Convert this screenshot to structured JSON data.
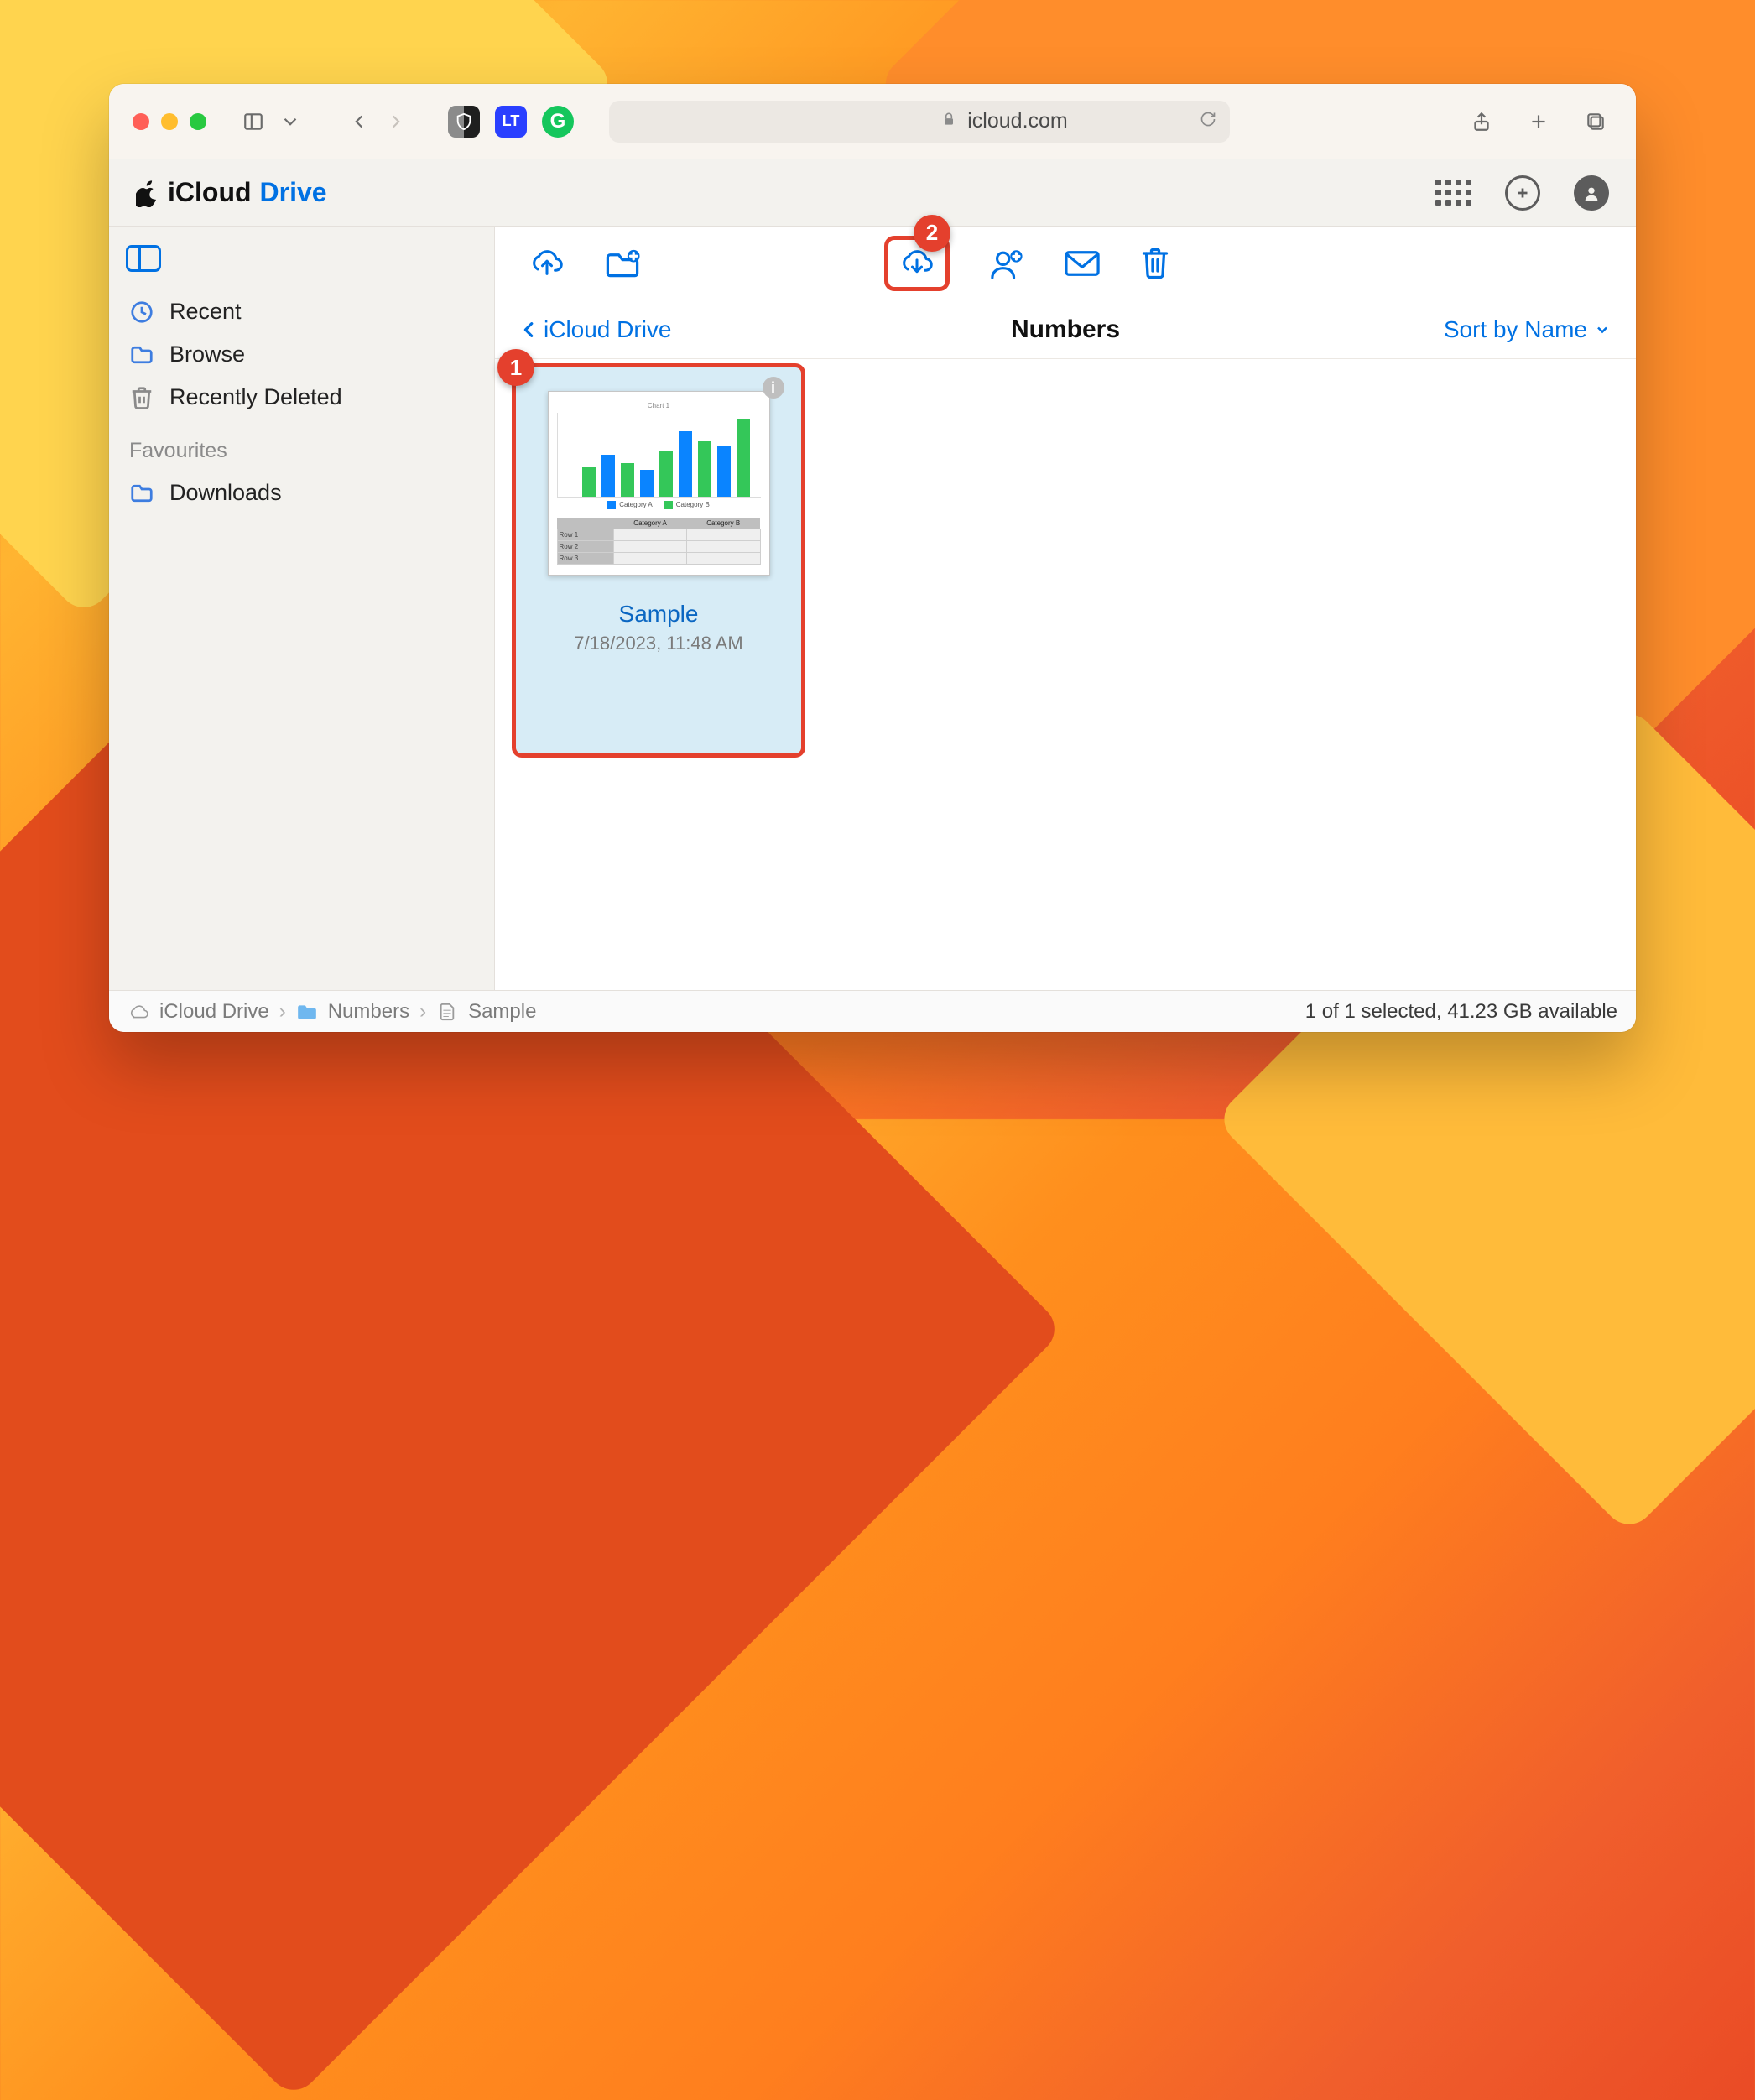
{
  "browser": {
    "url_host": "icloud.com"
  },
  "brand": {
    "title_a": "iCloud",
    "title_b": "Drive"
  },
  "sidebar": {
    "items": [
      {
        "label": "Recent"
      },
      {
        "label": "Browse"
      },
      {
        "label": "Recently Deleted"
      }
    ],
    "fav_header": "Favourites",
    "favourites": [
      {
        "label": "Downloads"
      }
    ]
  },
  "annotations": {
    "file": "1",
    "download": "2"
  },
  "crumb": {
    "back": "iCloud Drive",
    "title": "Numbers",
    "sort": "Sort by Name"
  },
  "files": [
    {
      "name": "Sample",
      "date": "7/18/2023, 11:48 AM"
    }
  ],
  "footer": {
    "crumbs": [
      "iCloud Drive",
      "Numbers",
      "Sample"
    ],
    "status": "1 of 1 selected, 41.23 GB available"
  }
}
